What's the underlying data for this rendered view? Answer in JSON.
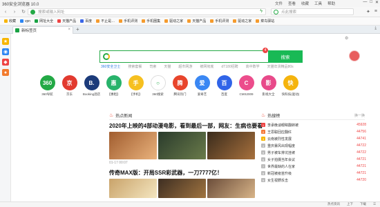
{
  "window": {
    "title": "360安全浏览器 10.0",
    "menu": [
      "文件",
      "查看",
      "收藏",
      "工具",
      "帮助"
    ],
    "win_buttons": [
      "—",
      "□",
      "✕"
    ]
  },
  "address": {
    "placeholder": "搜索或输入网址"
  },
  "search": {
    "placeholder": "点此搜索"
  },
  "bookmarks": [
    "收藏",
    "vpn",
    "网址大全",
    "天猫产品",
    "百度",
    "不止是…",
    "手机评测",
    "手机圈集",
    "驱动之家",
    "天猫产品",
    "手机评测",
    "驱动之家",
    "菜鸟驿站",
    "家电评测",
    "京东到家"
  ],
  "tab": {
    "label": "新标签页"
  },
  "home": {
    "search_button": "搜索",
    "badge": "4",
    "links": [
      "360安全卫士",
      "搜索套餐",
      "司索",
      "天猫",
      "超市网游",
      "被网彻底",
      "dT180招聘",
      "高中数学",
      "天猫年货精品80s"
    ],
    "grid": [
      {
        "label": "360导航",
        "text": "360"
      },
      {
        "label": "京东",
        "text": "京"
      },
      {
        "label": "Booking酒店",
        "text": "B."
      },
      {
        "label": "【惠租】",
        "text": "惠"
      },
      {
        "label": "【手机】",
        "text": "手"
      },
      {
        "label": "360搜索",
        "text": "○"
      },
      {
        "label": "腾讯热门",
        "text": "腾"
      },
      {
        "label": "爱奇艺",
        "text": "爱"
      },
      {
        "label": "百度",
        "text": "百"
      },
      {
        "label": "CMS2009",
        "text": "C"
      },
      {
        "label": "影视大全",
        "text": "影"
      },
      {
        "label": "快科技(驱动)",
        "text": "快"
      }
    ]
  },
  "news": {
    "section": "热点新闻",
    "headline1": "2020年上映的4部动漫电影，看到最后一部，网友：生病也要看",
    "meta1_time": "01-17 00:07",
    "meta1_extra": "",
    "headline2": "传奇MAX版：开局SSR彩武器，一刀7777亿！"
  },
  "hotsearch": {
    "section": "热搜榜",
    "more": "换一换",
    "items": [
      {
        "title": "李承晚谈眼睛翻转被",
        "count": "45928"
      },
      {
        "title": "王思聪回应翻红",
        "count": "44756"
      },
      {
        "title": "云南被烈性发展",
        "count": "44741"
      },
      {
        "title": "重庆暴风出现幅度",
        "count": "44722"
      },
      {
        "title": "男子被车排坑挂坡",
        "count": "44722"
      },
      {
        "title": "女子拍摄当年会议",
        "count": "44721"
      },
      {
        "title": "世界最缺的人在家",
        "count": "44721"
      },
      {
        "title": "新冠被疫苗升级",
        "count": "44721"
      },
      {
        "title": "女生视野反击",
        "count": "44720"
      }
    ]
  },
  "status": {
    "items": [
      "热点资讯",
      "上下",
      "下载",
      "☰"
    ]
  },
  "colors": {
    "green": "#19b955",
    "red": "#e44"
  }
}
